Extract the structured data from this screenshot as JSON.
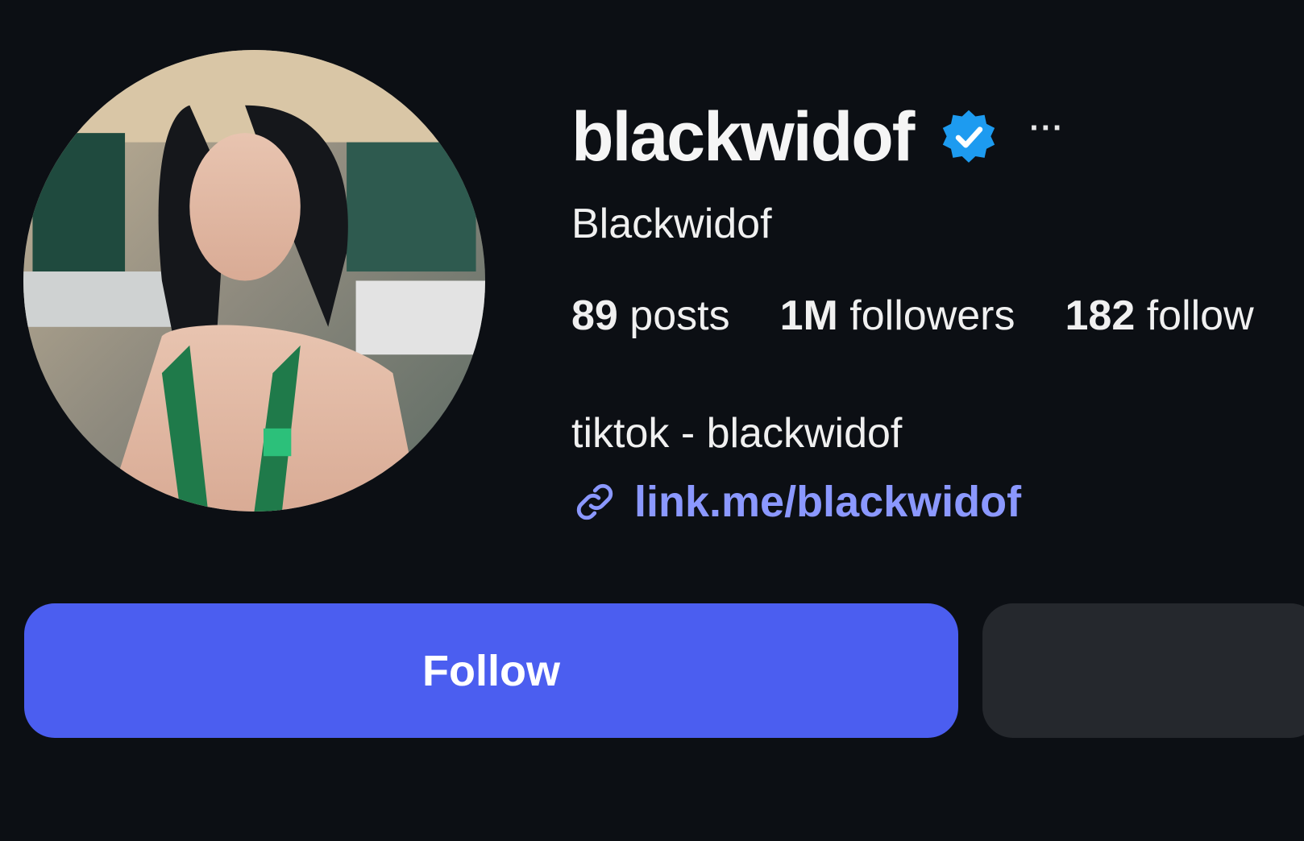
{
  "profile": {
    "username": "blackwidof",
    "display_name": "Blackwidof",
    "verified_icon": "verified-badge-icon",
    "more_icon": "more-options-icon",
    "more_label": "···",
    "stats": {
      "posts_count": "89",
      "posts_label": "posts",
      "followers_count": "1M",
      "followers_label": "followers",
      "following_count": "182",
      "following_label": "follow"
    },
    "bio": "tiktok - blackwidof",
    "link_icon": "link-icon",
    "link": "link.me/blackwidof"
  },
  "actions": {
    "follow_label": "Follow",
    "secondary_label": ""
  },
  "colors": {
    "background": "#0c0f14",
    "text": "#f5f5f5",
    "accent": "#4b5ef0",
    "link": "#8b98ff",
    "verified": "#1d9bf0",
    "secondary_button": "#25282d"
  }
}
